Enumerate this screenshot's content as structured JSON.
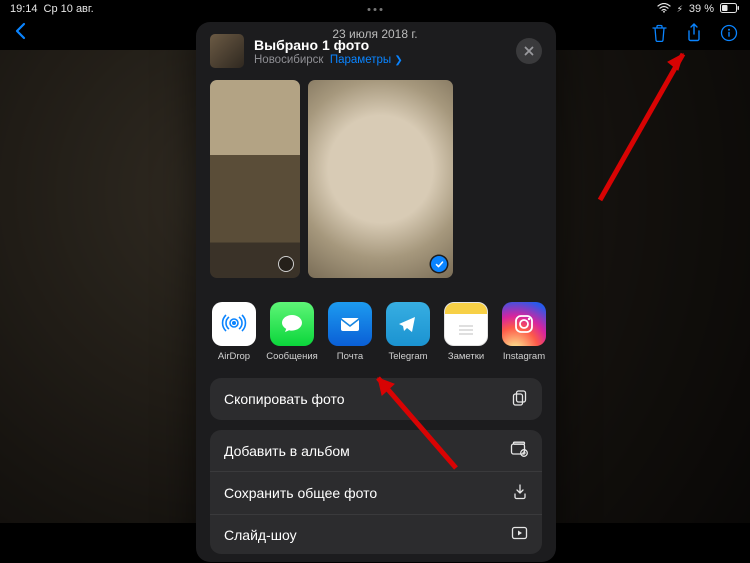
{
  "status": {
    "time": "19:14",
    "date": "Ср 10 авг.",
    "battery": "39 %"
  },
  "nav": {
    "date_title": "23 июля 2018 г."
  },
  "sheet": {
    "title": "Выбрано 1 фото",
    "location": "Новосибирск",
    "options": "Параметры"
  },
  "apps": {
    "airdrop": "AirDrop",
    "messages": "Сообщения",
    "mail": "Почта",
    "telegram": "Telegram",
    "notes": "Заметки",
    "instagram": "Instagram"
  },
  "actions": {
    "copy": "Скопировать фото",
    "add_album": "Добавить в альбом",
    "save_shared": "Сохранить общее фото",
    "slideshow": "Слайд-шоу"
  },
  "bottom_link": "Сохранить общее фото"
}
